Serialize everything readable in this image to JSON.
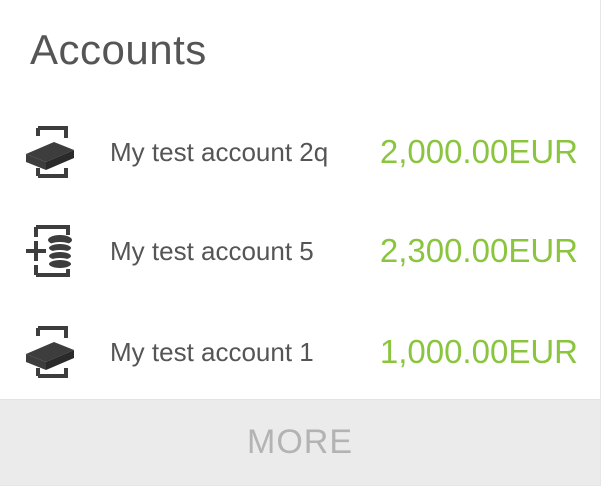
{
  "header": {
    "title": "Accounts"
  },
  "accounts": [
    {
      "name": "My test account 2q",
      "amount": "2,000.00",
      "currency": "EUR",
      "icon": "cash-transfer-icon"
    },
    {
      "name": "My test account 5",
      "amount": "2,300.00",
      "currency": "EUR",
      "icon": "coin-stack-add-icon"
    },
    {
      "name": "My test account 1",
      "amount": "1,000.00",
      "currency": "EUR",
      "icon": "cash-transfer-icon"
    }
  ],
  "footer": {
    "more_label": "MORE"
  },
  "colors": {
    "amount": "#8bc53f",
    "text": "#555555",
    "footer_bg": "#ebebeb",
    "footer_text": "#b3b3b3"
  }
}
